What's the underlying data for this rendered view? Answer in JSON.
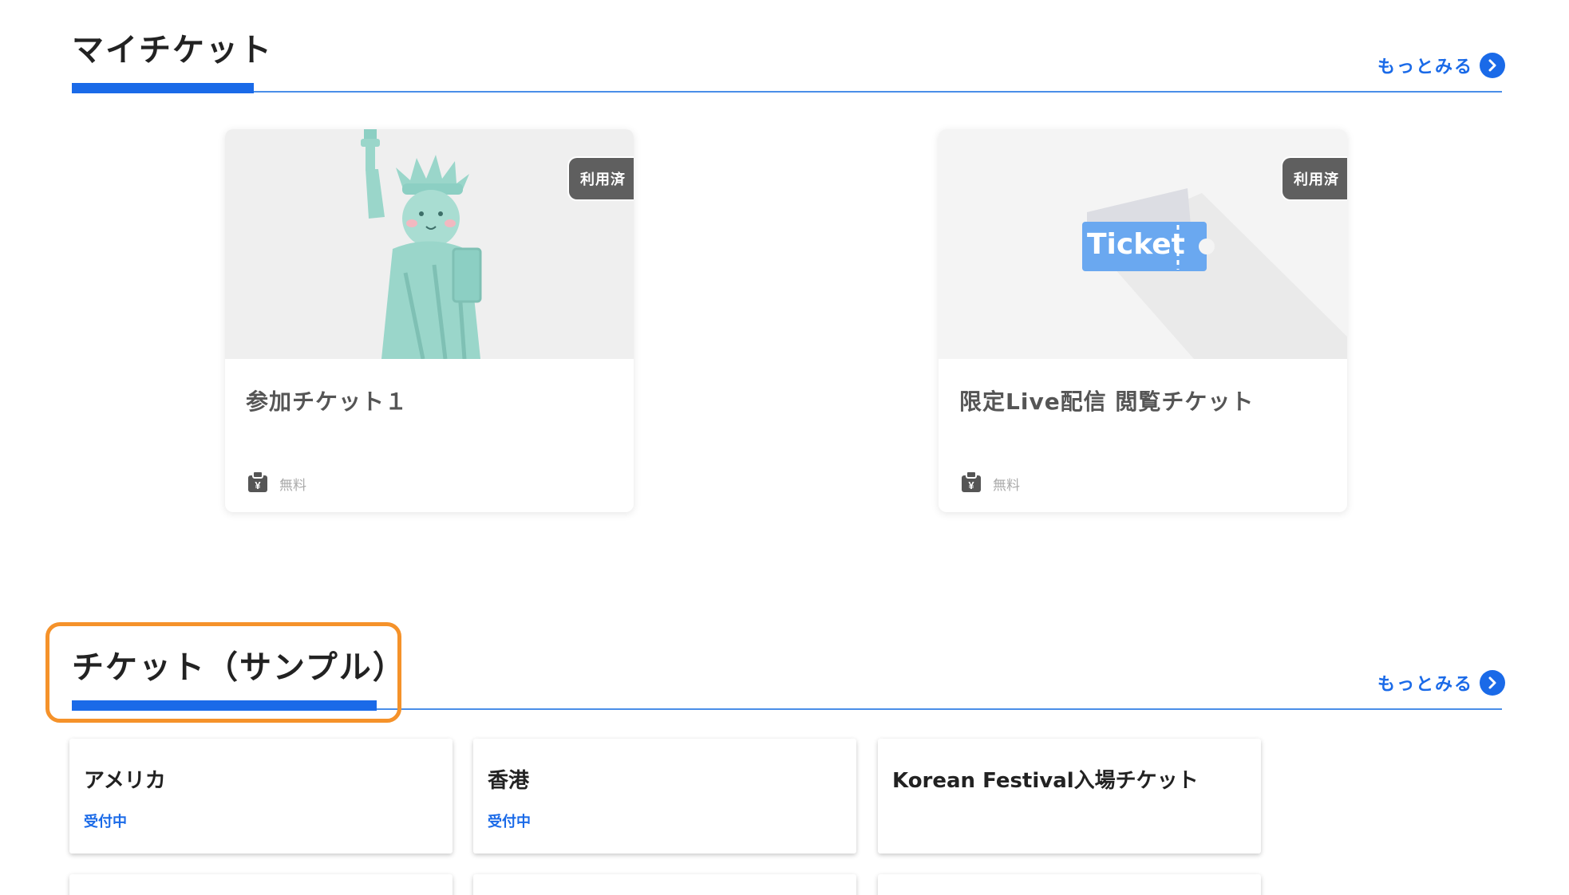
{
  "my_tickets": {
    "title": "マイチケット",
    "more_label": "もっとみる",
    "items": [
      {
        "name": "参加チケット１",
        "badge": "利用済",
        "price": "無料",
        "image": "statue-of-liberty-illustration"
      },
      {
        "name": "限定Live配信 閲覧チケット",
        "badge": "利用済",
        "price": "無料",
        "image": "ticket-illustration",
        "image_text": "Ticket"
      }
    ]
  },
  "sample_tickets": {
    "title": "チケット（サンプル）",
    "more_label": "もっとみる",
    "items": [
      {
        "name": "アメリカ",
        "status": "受付中"
      },
      {
        "name": "香港",
        "status": "受付中"
      },
      {
        "name": "Korean Festival入場チケット",
        "status": ""
      }
    ]
  },
  "colors": {
    "accent": "#1a6ae8",
    "highlight": "#f5922a",
    "badge": "#5f5f5f"
  }
}
